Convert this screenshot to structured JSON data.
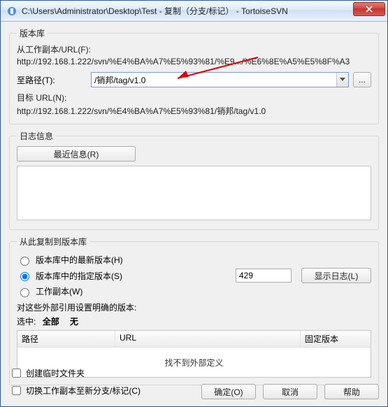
{
  "titlebar": {
    "path": "C:\\Users\\Administrator\\Desktop\\Test - 复制（分支/标记） - TortoiseSVN",
    "close": "X"
  },
  "repo": {
    "legend": "版本库",
    "from_label": "从工作副本/URL(F):",
    "from_url": "http://192.168.1.222/svn/%E4%BA%A7%E5%93%81/%E9.../%E6%8E%A5%E5%8F%A3",
    "to_label": "至路径(T):",
    "to_value": "/销邦/tag/v1.0",
    "browse": "...",
    "dest_label": "目标 URL(N):",
    "dest_url": "http://192.168.1.222/svn/%E4%BA%A7%E5%93%81/销邦/tag/v1.0"
  },
  "log": {
    "legend": "日志信息",
    "recent_btn": "最近信息(R)",
    "text": ""
  },
  "copy": {
    "legend": "从此复制到版本库",
    "head": "版本库中的最新版本(H)",
    "spec": "版本库中的指定版本(S)",
    "rev_value": "429",
    "showlog_btn": "显示日志(L)",
    "wc": "工作副本(W)",
    "ext_label": "对这些外部引用设置明确的版本:",
    "select_prefix": "选中:",
    "select_all": "全部",
    "select_none": "无",
    "col_path": "路径",
    "col_url": "URL",
    "col_fixed": "固定版本",
    "empty": "找不到外部定义"
  },
  "bottom": {
    "tempfolder": "创建临时文件夹",
    "switch": "切换工作副本至新分支/标记(C)",
    "ok": "确定(O)",
    "cancel": "取消",
    "help": "帮助"
  }
}
